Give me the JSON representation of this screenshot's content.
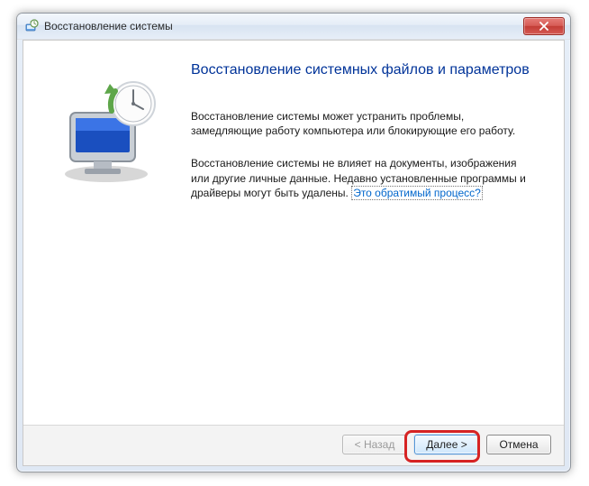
{
  "window": {
    "title": "Восстановление системы"
  },
  "content": {
    "heading": "Восстановление системных файлов и параметров",
    "para1": "Восстановление системы может устранить проблемы, замедляющие работу компьютера или блокирующие его работу.",
    "para2_lead": "Восстановление системы не влияет на документы, изображения или другие личные данные. Недавно установленные программы и драйверы могут быть удалены. ",
    "help_link": "Это обратимый процесс?"
  },
  "footer": {
    "back_label": "< Назад",
    "next_label": "Далее >",
    "cancel_label": "Отмена"
  }
}
